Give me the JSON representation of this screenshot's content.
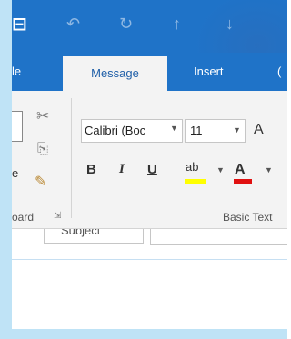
{
  "titlebar": {
    "icons": {
      "app": "outlook-app-icon",
      "undo": "undo-icon",
      "redo": "redo-icon",
      "up": "up-arrow-icon",
      "down": "down-arrow-icon"
    }
  },
  "tabs": [
    {
      "label": "le"
    },
    {
      "label": "Message"
    },
    {
      "label": "Insert"
    },
    {
      "label": "("
    }
  ],
  "ribbon": {
    "clipboard": {
      "paste_label": "e",
      "group_label": "oard",
      "icons": [
        "cut-icon",
        "copy-icon",
        "format-painter-icon",
        "dialog-launcher-icon"
      ]
    },
    "basic_text": {
      "font_name": "Calibri (Boc",
      "font_size": "11",
      "grow_font_label": "A",
      "bold_label": "B",
      "italic_label": "I",
      "underline_label": "U",
      "highlight_label": "ab",
      "font_color_label": "A",
      "group_label": "Basic Text",
      "colors": {
        "highlight": "#ffff00",
        "font_color": "#e01010"
      }
    }
  },
  "compose": {
    "subject_label": "Subject"
  },
  "colors": {
    "titlebar": "#1f73c8",
    "ribbon_bg": "#f3f3f3",
    "frame": "#bfe3f6"
  }
}
